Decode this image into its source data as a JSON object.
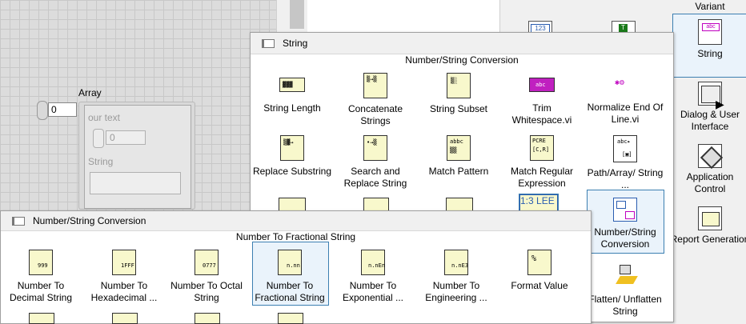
{
  "front_panel": {
    "array_label": "Array",
    "array_index": "0",
    "cluster_label": "our text",
    "numeric_value": "0",
    "string_label": "String",
    "string_value": ""
  },
  "right_palette": {
    "variant_label": "Variant",
    "items": [
      {
        "label": "String"
      },
      {
        "label": "Dialog & User Interface"
      },
      {
        "label": "Application Control"
      },
      {
        "label": "Report Generation"
      }
    ]
  },
  "string_palette": {
    "title": "String",
    "subtitle": "Number/String Conversion",
    "items": [
      {
        "label": "String Length"
      },
      {
        "label": "Concatenate Strings"
      },
      {
        "label": "String Subset"
      },
      {
        "label": "Trim Whitespace.vi"
      },
      {
        "label": "Normalize End Of Line.vi"
      },
      {
        "label": "Replace Substring"
      },
      {
        "label": "Search and Replace String"
      },
      {
        "label": "Match Pattern"
      },
      {
        "label": "Match Regular Expression"
      },
      {
        "label": "Path/Array/ String ..."
      },
      {
        "label": "Number/String Conversion"
      },
      {
        "label": "Flatten/ Unflatten String"
      }
    ]
  },
  "numstr_palette": {
    "title": "Number/String Conversion",
    "subtitle": "Number To Fractional String",
    "items": [
      {
        "label": "Number To Decimal String"
      },
      {
        "label": "Number To Hexadecimal ..."
      },
      {
        "label": "Number To Octal String"
      },
      {
        "label": "Number To Fractional String"
      },
      {
        "label": "Number To Exponential ..."
      },
      {
        "label": "Number To Engineering ..."
      },
      {
        "label": "Format Value"
      }
    ]
  },
  "icons": {
    "string_length": "999",
    "decimal": "999",
    "hex": "1FFF",
    "octal": "0777",
    "fractional": "n.nn",
    "exponential": "n.nEn",
    "engineering": "n.nE3",
    "format": "%",
    "numeric_ctrl": "123",
    "string_ctrl": "abc",
    "numstr_sel": "1:3 LEE"
  }
}
